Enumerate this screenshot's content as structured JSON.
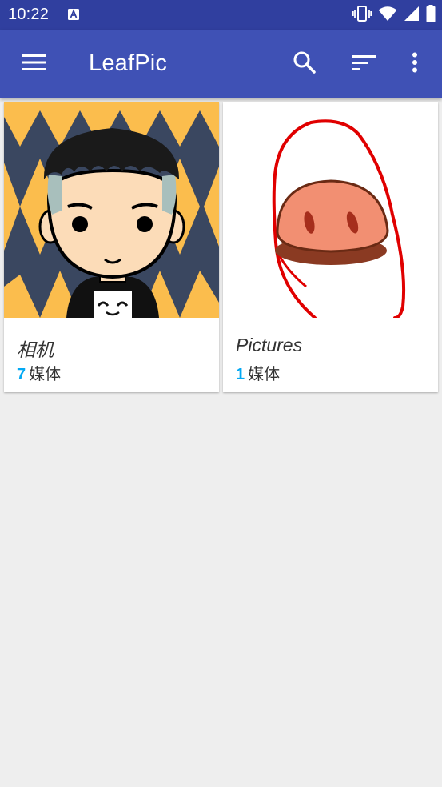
{
  "status_bar": {
    "time": "10:22",
    "icons": [
      "a-notification-icon",
      "vibrate-icon",
      "wifi-icon",
      "signal-icon",
      "battery-icon"
    ]
  },
  "toolbar": {
    "title": "LeafPic",
    "icons": [
      "menu-icon",
      "search-icon",
      "sort-icon",
      "more-vert-icon"
    ],
    "color": "#3f51b5",
    "status_color": "#303f9f"
  },
  "albums": [
    {
      "name": "相机",
      "count": "7",
      "media_label": "媒体",
      "thumbnail": "cartoon-avatar-image"
    },
    {
      "name": "Pictures",
      "count": "1",
      "media_label": "媒体",
      "thumbnail": "pig-nose-drawing-image"
    }
  ],
  "colors": {
    "accent": "#03a9f4",
    "background": "#eeeeee",
    "card": "#ffffff"
  }
}
